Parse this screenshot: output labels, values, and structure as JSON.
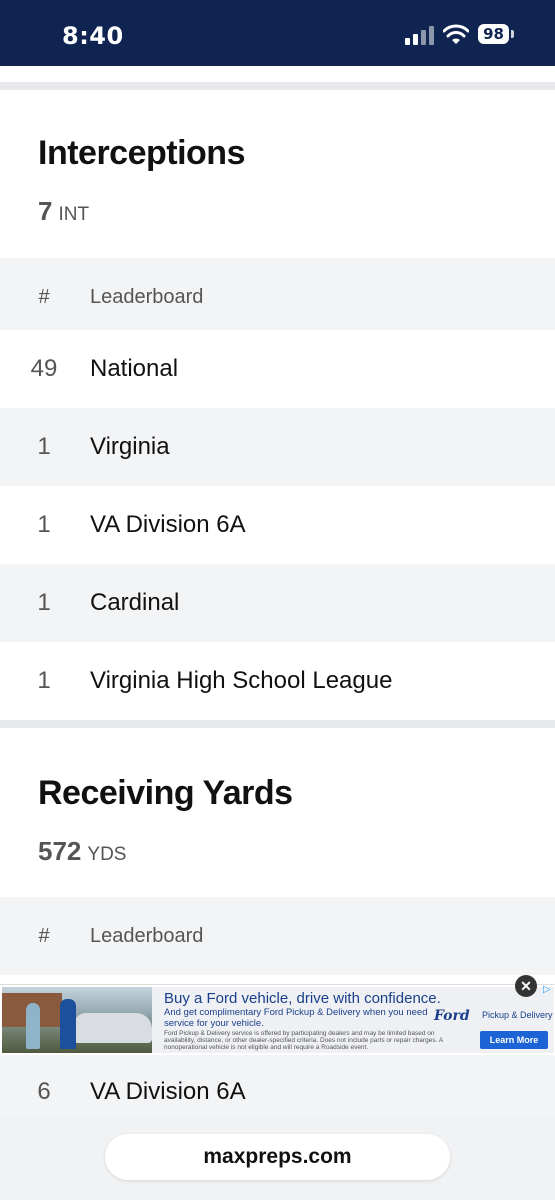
{
  "status_bar": {
    "time": "8:40",
    "battery": "98"
  },
  "interceptions": {
    "title": "Interceptions",
    "stat_value": "7",
    "stat_unit": "INT",
    "header": {
      "rank": "#",
      "name": "Leaderboard"
    },
    "rows": [
      {
        "rank": "49",
        "name": "National"
      },
      {
        "rank": "1",
        "name": "Virginia"
      },
      {
        "rank": "1",
        "name": "VA Division 6A"
      },
      {
        "rank": "1",
        "name": "Cardinal"
      },
      {
        "rank": "1",
        "name": "Virginia High School League"
      }
    ]
  },
  "receiving": {
    "title": "Receiving Yards",
    "stat_value": "572",
    "stat_unit": "YDS",
    "header": {
      "rank": "#",
      "name": "Leaderboard"
    },
    "partial_row": {
      "rank": "6",
      "name": "VA Division 6A"
    }
  },
  "ad": {
    "headline": "Buy a Ford vehicle, drive with confidence.",
    "subline": "And get complimentary Ford Pickup & Delivery when you need service for your vehicle.",
    "fine_print": "Ford Pickup & Delivery service is offered by participating dealers and may be limited based on availability, distance, or other dealer-specified criteria. Does not include parts or repair charges. A nonoperational vehicle is not eligible and will require a Roadside event.",
    "brand": "Ford",
    "brand_tag": "Pickup & Delivery",
    "cta": "Learn More",
    "close": "✕"
  },
  "browser": {
    "url": "maxpreps.com"
  }
}
